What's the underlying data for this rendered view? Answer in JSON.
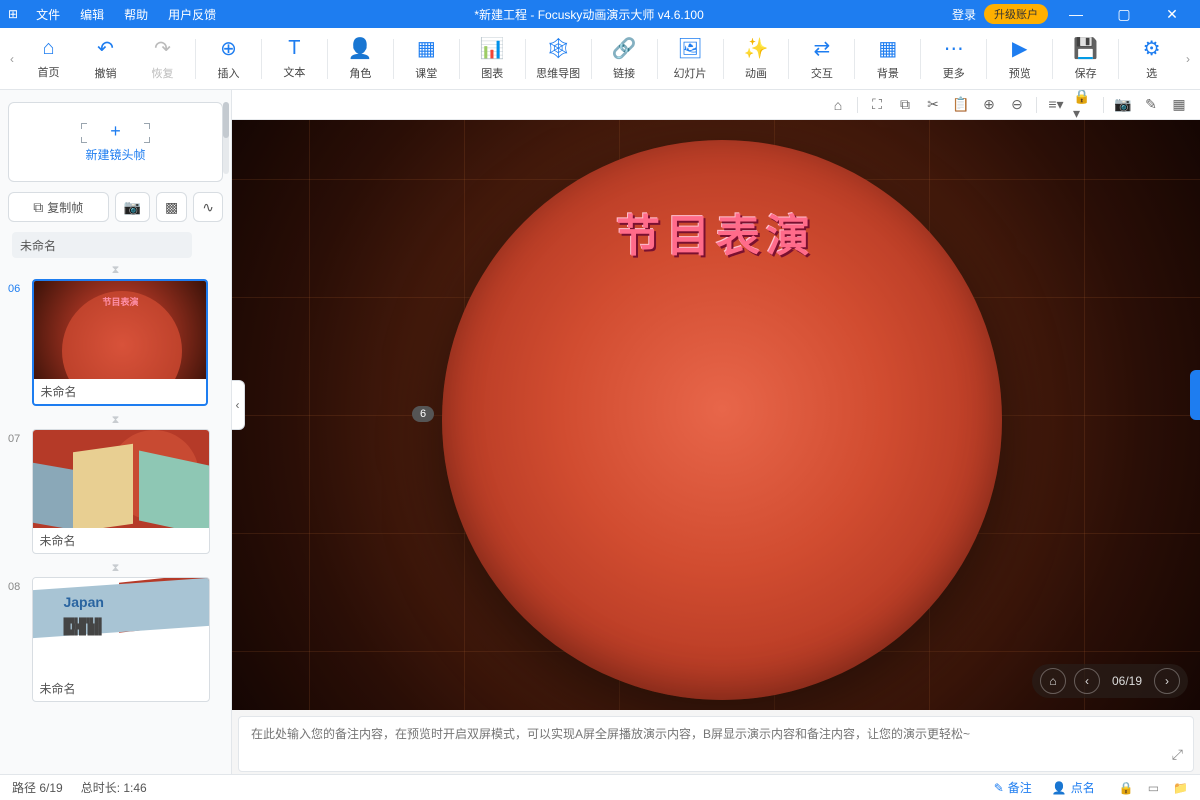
{
  "titlebar": {
    "menus": [
      "文件",
      "编辑",
      "帮助",
      "用户反馈"
    ],
    "title": "*新建工程 - Focusky动画演示大师  v4.6.100",
    "login": "登录",
    "upgrade": "升级账户"
  },
  "toolbar": {
    "nav_left": "‹",
    "nav_right": "›",
    "items": [
      {
        "icon": "⌂",
        "label": "首页"
      },
      {
        "icon": "↶",
        "label": "撤销"
      },
      {
        "icon": "↷",
        "label": "恢复",
        "gray": true
      },
      {
        "sep": true
      },
      {
        "icon": "⊕",
        "label": "插入"
      },
      {
        "sep": true
      },
      {
        "icon": "T",
        "label": "文本"
      },
      {
        "sep": true
      },
      {
        "icon": "👤",
        "label": "角色"
      },
      {
        "sep": true
      },
      {
        "icon": "▦",
        "label": "课堂"
      },
      {
        "sep": true
      },
      {
        "icon": "📊",
        "label": "图表"
      },
      {
        "sep": true
      },
      {
        "icon": "🕸",
        "label": "思维导图"
      },
      {
        "sep": true
      },
      {
        "icon": "🔗",
        "label": "链接"
      },
      {
        "sep": true
      },
      {
        "icon": "🖼",
        "label": "幻灯片"
      },
      {
        "sep": true
      },
      {
        "icon": "✨",
        "label": "动画"
      },
      {
        "sep": true
      },
      {
        "icon": "⇄",
        "label": "交互"
      },
      {
        "sep": true
      },
      {
        "icon": "▦",
        "label": "背景"
      },
      {
        "sep": true
      },
      {
        "icon": "⋯",
        "label": "更多"
      },
      {
        "sep": true
      },
      {
        "icon": "▶",
        "label": "预览"
      },
      {
        "sep": true
      },
      {
        "icon": "💾",
        "label": "保存"
      },
      {
        "sep": true
      },
      {
        "icon": "⚙",
        "label": "选"
      }
    ]
  },
  "sidebar": {
    "new_frame": "新建镜头帧",
    "plus": "+",
    "copy_frame": "复制帧",
    "label_value": "未命名",
    "thumbs": [
      {
        "num": "06",
        "caption": "未命名",
        "thumb_title": "节目表演",
        "active": true
      },
      {
        "num": "07",
        "caption": "未命名"
      },
      {
        "num": "08",
        "caption": "未命名",
        "japan": "Japan"
      }
    ]
  },
  "canvas": {
    "slide_title": "节目表演",
    "frame_badge": "6",
    "nav_page": "06/19"
  },
  "notes": {
    "placeholder": "在此处输入您的备注内容，在预览时开启双屏模式，可以实现A屏全屏播放演示内容，B屏显示演示内容和备注内容，让您的演示更轻松~"
  },
  "statusbar": {
    "path": "路径 6/19",
    "duration": "总时长: 1:46",
    "notes_btn": "备注",
    "click_btn": "点名"
  }
}
